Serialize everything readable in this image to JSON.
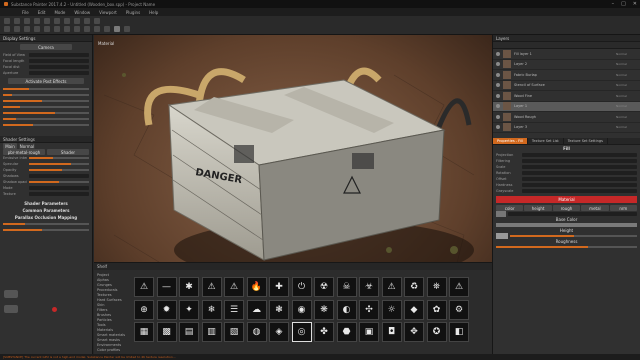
{
  "window": {
    "title": "Substance Painter 2017.4.2 - Untitled (Wooden_box.spp) - Project Name",
    "controls": [
      "–",
      "□",
      "✕"
    ]
  },
  "menu": [
    "File",
    "Edit",
    "Mode",
    "Window",
    "Viewport",
    "Plugins",
    "Help"
  ],
  "left_panel": {
    "header": "Display Settings",
    "camera_button": "Camera",
    "fields": [
      "Field of View",
      "Focal length",
      "Focal dist",
      "Aperture"
    ],
    "effects_button": "Activate Post Effects",
    "slider_labels": [
      "",
      "",
      "",
      "",
      "",
      "",
      ""
    ],
    "shader_header": "Shader Settings",
    "shader_tabs": [
      "Main",
      "Normal"
    ],
    "shader_buttons": [
      "pbr-metal-rough",
      "Shader"
    ],
    "shader_sections": [
      "Shader Parameters",
      "Common Parameters",
      "Parallax Occlusion Mapping"
    ],
    "sub_labels": [
      "Emissive intensity",
      "Specular",
      "Opacity",
      "Shadows",
      "Shadow opacity",
      "Mode",
      "Texture"
    ]
  },
  "viewport": {
    "label": "Material",
    "crate_text": "DANGER"
  },
  "right_panel": {
    "layers_header": "Layers",
    "layers": [
      {
        "name": "Fill layer 1",
        "blend": "Normal",
        "sel": false
      },
      {
        "name": "Layer 2",
        "blend": "Normal",
        "sel": false
      },
      {
        "name": "Fabric Burlap",
        "blend": "Normal",
        "sel": false
      },
      {
        "name": "Stencil of Surface",
        "blend": "Normal",
        "sel": false
      },
      {
        "name": "Wood Fine",
        "blend": "Normal",
        "sel": false
      },
      {
        "name": "Layer 1",
        "blend": "Normal",
        "sel": true
      },
      {
        "name": "Wood Rough",
        "blend": "Normal",
        "sel": false
      },
      {
        "name": "Layer 3",
        "blend": "Normal",
        "sel": false
      }
    ],
    "tabs": [
      "Properties - Fill",
      "Texture Set List",
      "Texture Set Settings"
    ],
    "fill_label": "Fill",
    "prop_labels": [
      "Projection",
      "Filtering",
      "Scale",
      "Rotation",
      "Offset",
      "Hardness",
      "Grayscale"
    ],
    "material_button": "Material",
    "channels": [
      "color",
      "height",
      "rough",
      "metal",
      "nrm"
    ],
    "base_color_label": "Base Color",
    "height_label": "Height",
    "roughness_label": "Roughness"
  },
  "shelf": {
    "header": "Shelf",
    "categories": [
      "Project",
      "Alphas",
      "Grunges",
      "Procedurals",
      "Textures",
      "Hard Surfaces",
      "Skin",
      "Filters",
      "Brushes",
      "Particles",
      "Tools",
      "Materials",
      "Smart materials",
      "Smart masks",
      "Environments",
      "Color profiles"
    ],
    "tiles": [
      "⚠",
      "—",
      "✱",
      "⚠",
      "⚠",
      "🔥",
      "✚",
      "⏻",
      "☢",
      "☠",
      "☣",
      "⚠",
      "♻",
      "⛯",
      "⚠",
      "⊕",
      "✹",
      "✦",
      "❄",
      "☰",
      "☁",
      "❃",
      "◉",
      "❋",
      "◐",
      "✣",
      "☼",
      "◆",
      "✿",
      "⚙",
      "▦",
      "▩",
      "▤",
      "▥",
      "▧",
      "◍",
      "◈",
      "◎",
      "✤",
      "⬣",
      "▣",
      "◘",
      "✥",
      "✪",
      "◧"
    ]
  },
  "status": "[SUBSTANCE] The current GPU is not a high-end model. Substance Painter will be limited to 4K texture resolution...",
  "colors": {
    "accent": "#d2691e",
    "red": "#c62828"
  }
}
